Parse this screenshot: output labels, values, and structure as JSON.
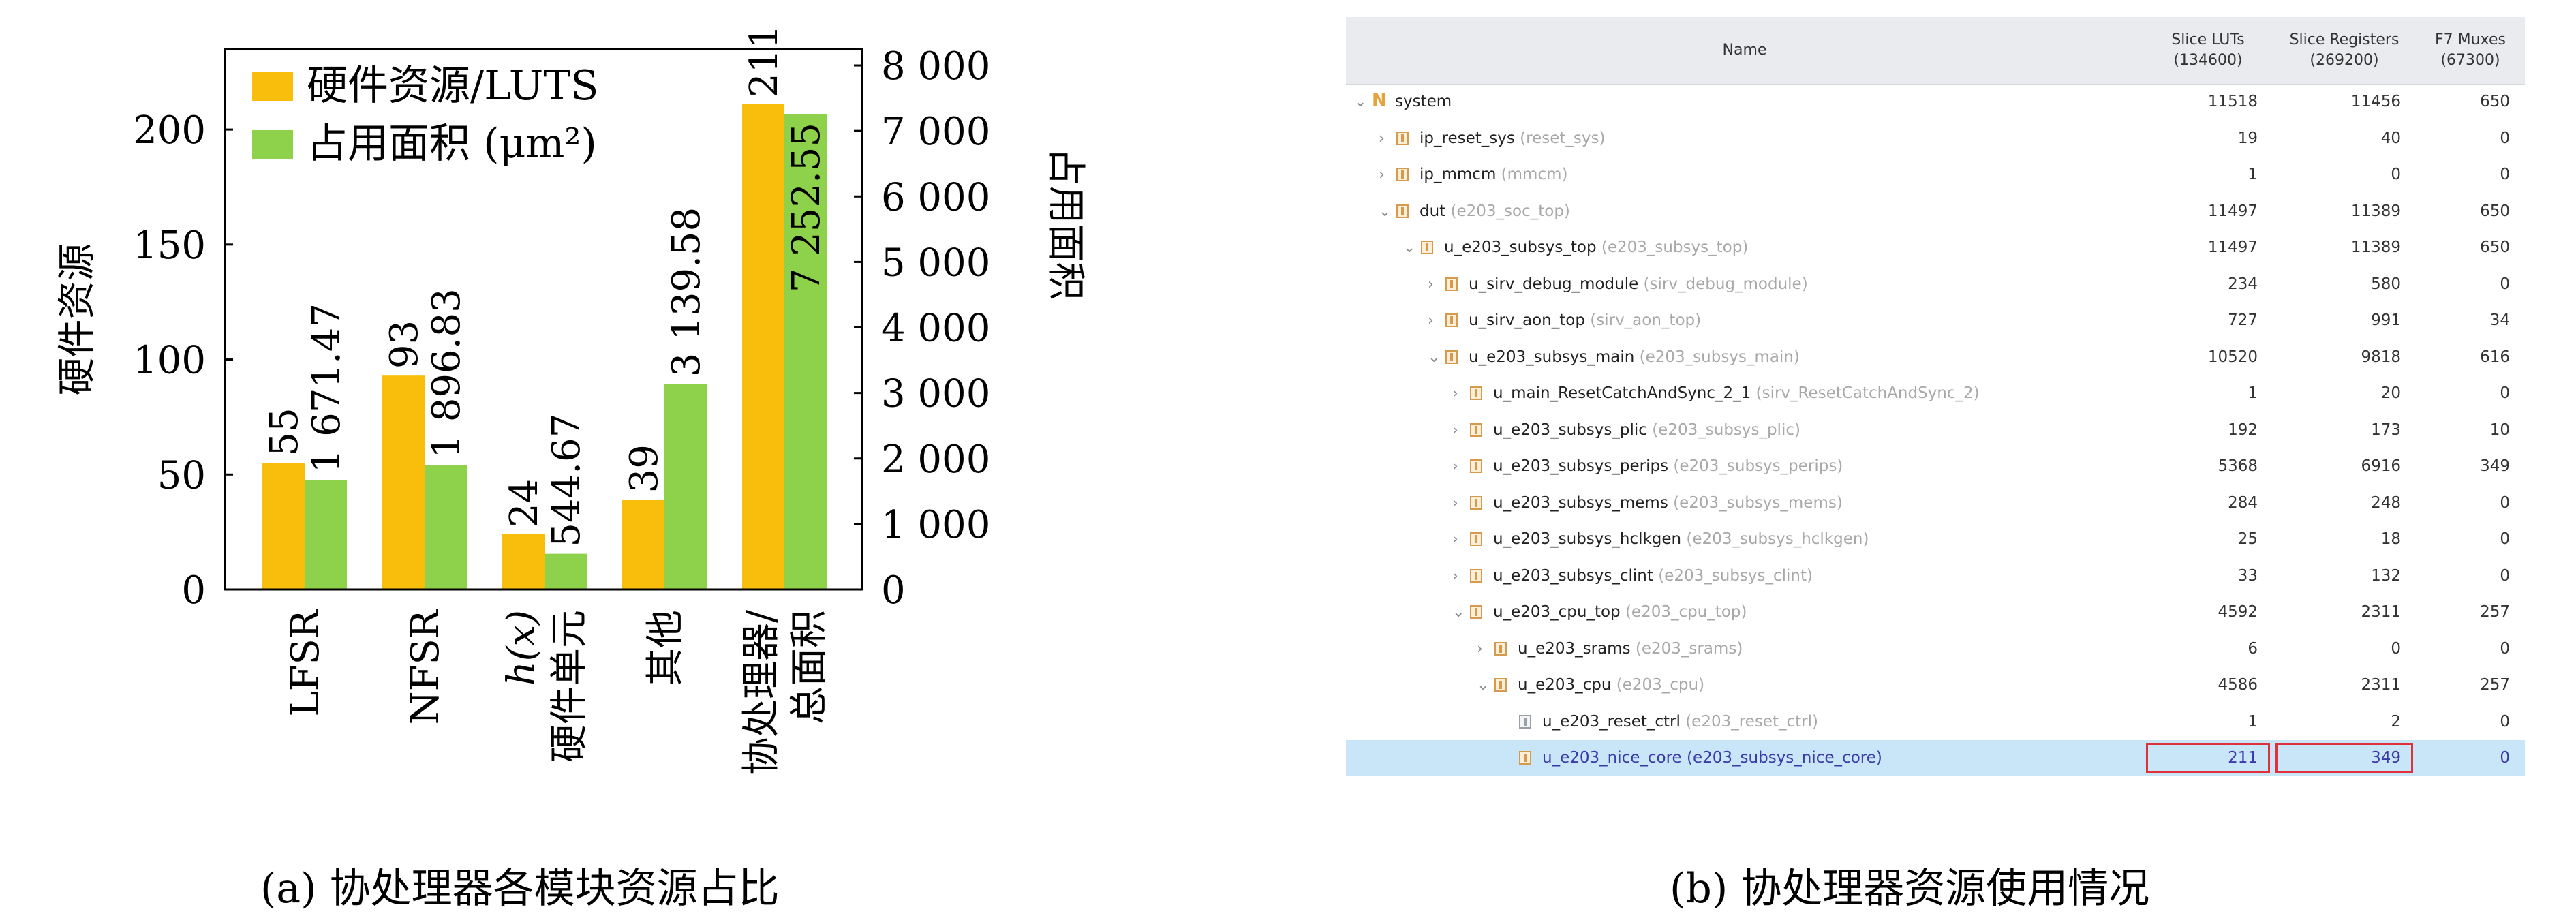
{
  "chart_data": {
    "type": "bar",
    "categories": [
      "LFSR",
      "NFSR",
      "h(x)\n硬件单元",
      "其他",
      "协处理器/\n总面积"
    ],
    "series": [
      {
        "name": "硬件资源/LUTS",
        "axis": "left",
        "color": "#f9bd0b",
        "values": [
          55,
          93,
          24,
          39,
          211
        ],
        "labels": [
          "55",
          "93",
          "24",
          "39",
          "211"
        ]
      },
      {
        "name": "占用面积 (μm²)",
        "axis": "right",
        "color": "#8ed14b",
        "values": [
          1671.47,
          1896.83,
          544.67,
          3139.58,
          7252.55
        ],
        "labels": [
          "1 671.47",
          "1 896.83",
          "544.67",
          "3 139.58",
          "7 252.55"
        ]
      }
    ],
    "ylabel": "硬件资源",
    "y2label": "占用面积",
    "ylim": [
      0,
      235
    ],
    "y2lim": [
      0,
      8250
    ],
    "yticks": [
      0,
      50,
      100,
      150,
      200
    ],
    "y2ticks": [
      "0",
      "1 000",
      "2 000",
      "3 000",
      "4 000",
      "5 000",
      "6 000",
      "7 000",
      "8 000"
    ],
    "legend": "top-left",
    "grid": false
  },
  "captions": {
    "a": "(a) 协处理器各模块资源占比",
    "b": "(b) 协处理器资源使用情况"
  },
  "table": {
    "headers": {
      "name": "Name",
      "luts": [
        "Slice LUTs",
        "(134600)"
      ],
      "regs": [
        "Slice Registers",
        "(269200)"
      ],
      "f7": [
        "F7 Muxes",
        "(67300)"
      ]
    },
    "rows": [
      {
        "depth": 0,
        "arrow": "⌄",
        "icon": "system",
        "name": "system",
        "sub": "",
        "luts": "11518",
        "regs": "11456",
        "f7": "650"
      },
      {
        "depth": 1,
        "arrow": "›",
        "icon": "block",
        "name": "ip_reset_sys",
        "sub": "(reset_sys)",
        "luts": "19",
        "regs": "40",
        "f7": "0"
      },
      {
        "depth": 1,
        "arrow": "›",
        "icon": "block",
        "name": "ip_mmcm",
        "sub": "(mmcm)",
        "luts": "1",
        "regs": "0",
        "f7": "0"
      },
      {
        "depth": 1,
        "arrow": "⌄",
        "icon": "block",
        "name": "dut",
        "sub": "(e203_soc_top)",
        "luts": "11497",
        "regs": "11389",
        "f7": "650"
      },
      {
        "depth": 2,
        "arrow": "⌄",
        "icon": "block",
        "name": "u_e203_subsys_top",
        "sub": "(e203_subsys_top)",
        "luts": "11497",
        "regs": "11389",
        "f7": "650"
      },
      {
        "depth": 3,
        "arrow": "›",
        "icon": "block",
        "name": "u_sirv_debug_module",
        "sub": "(sirv_debug_module)",
        "luts": "234",
        "regs": "580",
        "f7": "0"
      },
      {
        "depth": 3,
        "arrow": "›",
        "icon": "block",
        "name": "u_sirv_aon_top",
        "sub": "(sirv_aon_top)",
        "luts": "727",
        "regs": "991",
        "f7": "34"
      },
      {
        "depth": 3,
        "arrow": "⌄",
        "icon": "block",
        "name": "u_e203_subsys_main",
        "sub": "(e203_subsys_main)",
        "luts": "10520",
        "regs": "9818",
        "f7": "616"
      },
      {
        "depth": 4,
        "arrow": "›",
        "icon": "block",
        "name": "u_main_ResetCatchAndSync_2_1",
        "sub": "(sirv_ResetCatchAndSync_2)",
        "luts": "1",
        "regs": "20",
        "f7": "0"
      },
      {
        "depth": 4,
        "arrow": "›",
        "icon": "block",
        "name": "u_e203_subsys_plic",
        "sub": "(e203_subsys_plic)",
        "luts": "192",
        "regs": "173",
        "f7": "10"
      },
      {
        "depth": 4,
        "arrow": "›",
        "icon": "block",
        "name": "u_e203_subsys_perips",
        "sub": "(e203_subsys_perips)",
        "luts": "5368",
        "regs": "6916",
        "f7": "349"
      },
      {
        "depth": 4,
        "arrow": "›",
        "icon": "block",
        "name": "u_e203_subsys_mems",
        "sub": "(e203_subsys_mems)",
        "luts": "284",
        "regs": "248",
        "f7": "0"
      },
      {
        "depth": 4,
        "arrow": "›",
        "icon": "block",
        "name": "u_e203_subsys_hclkgen",
        "sub": "(e203_subsys_hclkgen)",
        "luts": "25",
        "regs": "18",
        "f7": "0"
      },
      {
        "depth": 4,
        "arrow": "›",
        "icon": "block",
        "name": "u_e203_subsys_clint",
        "sub": "(e203_subsys_clint)",
        "luts": "33",
        "regs": "132",
        "f7": "0"
      },
      {
        "depth": 4,
        "arrow": "⌄",
        "icon": "block",
        "name": "u_e203_cpu_top",
        "sub": "(e203_cpu_top)",
        "luts": "4592",
        "regs": "2311",
        "f7": "257"
      },
      {
        "depth": 5,
        "arrow": "›",
        "icon": "block",
        "name": "u_e203_srams",
        "sub": "(e203_srams)",
        "luts": "6",
        "regs": "0",
        "f7": "0"
      },
      {
        "depth": 5,
        "arrow": "⌄",
        "icon": "block",
        "name": "u_e203_cpu",
        "sub": "(e203_cpu)",
        "luts": "4586",
        "regs": "2311",
        "f7": "257"
      },
      {
        "depth": 6,
        "arrow": "",
        "icon": "leaf",
        "name": "u_e203_reset_ctrl",
        "sub": "(e203_reset_ctrl)",
        "luts": "1",
        "regs": "2",
        "f7": "0"
      },
      {
        "depth": 6,
        "arrow": "",
        "icon": "block",
        "name": "u_e203_nice_core",
        "sub": "(e203_subsys_nice_core)",
        "luts": "211",
        "regs": "349",
        "f7": "0",
        "selected": true,
        "highlight": [
          "luts",
          "regs"
        ]
      }
    ]
  },
  "colors": {
    "lut_bar": "#f9bd0b",
    "area_bar": "#8ed14b",
    "selection": "#c9e6f8",
    "highlight_box": "#e0303a"
  }
}
